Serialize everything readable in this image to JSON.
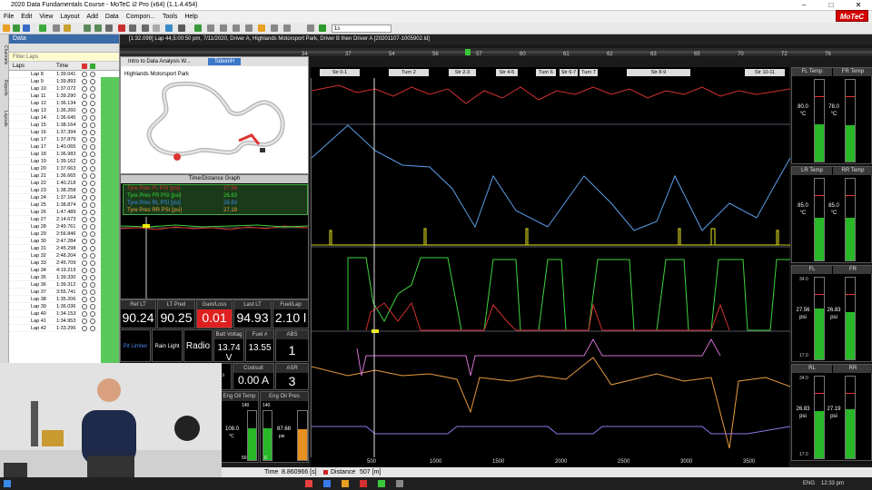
{
  "window": {
    "title": "2020 Data Fundamentals Course - MoTeC i2 Pro (x64) (1.1.4.454)"
  },
  "menu": [
    "File",
    "Edit",
    "View",
    "Layout",
    "Add",
    "Data",
    "Compon...",
    "Tools",
    "Help"
  ],
  "brand": {
    "logo": "MoTeC"
  },
  "toolbar": {
    "lap_selector": "1s"
  },
  "side_tabs": [
    "Channels",
    "Reports",
    "Layouts"
  ],
  "data_panel": {
    "title": "Data",
    "filter_placeholder": "Filter Laps",
    "col_laps": "Laps",
    "col_time": "Time",
    "laps": [
      {
        "lap": "Lap 8",
        "time": "1:39.041"
      },
      {
        "lap": "Lap 9",
        "time": "1:39.893"
      },
      {
        "lap": "Lap 10",
        "time": "1:37.072"
      },
      {
        "lap": "Lap 11",
        "time": "1:39.290"
      },
      {
        "lap": "Lap 12",
        "time": "1:36.134"
      },
      {
        "lap": "Lap 13",
        "time": "1:36.260"
      },
      {
        "lap": "Lap 14",
        "time": "1:36.645"
      },
      {
        "lap": "Lap 15",
        "time": "1:38.164"
      },
      {
        "lap": "Lap 16",
        "time": "1:37.394"
      },
      {
        "lap": "Lap 17",
        "time": "1:37.879"
      },
      {
        "lap": "Lap 17",
        "time": "1:40.065"
      },
      {
        "lap": "Lap 18",
        "time": "1:36.983"
      },
      {
        "lap": "Lap 19",
        "time": "1:39.162"
      },
      {
        "lap": "Lap 20",
        "time": "1:37.663"
      },
      {
        "lap": "Lap 21",
        "time": "1:36.665"
      },
      {
        "lap": "Lap 22",
        "time": "1:40.218"
      },
      {
        "lap": "Lap 23",
        "time": "1:38.258"
      },
      {
        "lap": "Lap 24",
        "time": "1:37.164"
      },
      {
        "lap": "Lap 25",
        "time": "1:38.874"
      },
      {
        "lap": "Lap 26",
        "time": "1:47.489"
      },
      {
        "lap": "Lap 27",
        "time": "2:14.673"
      },
      {
        "lap": "Lap 28",
        "time": "2:49.761"
      },
      {
        "lap": "Lap 29",
        "time": "2:56.846"
      },
      {
        "lap": "Lap 30",
        "time": "2:47.284"
      },
      {
        "lap": "Lap 31",
        "time": "2:45.298"
      },
      {
        "lap": "Lap 32",
        "time": "2:48.204"
      },
      {
        "lap": "Lap 33",
        "time": "2:45.709"
      },
      {
        "lap": "Lap 34",
        "time": "4:19.219"
      },
      {
        "lap": "Lap 35",
        "time": "1:39.330"
      },
      {
        "lap": "Lap 36",
        "time": "1:39.312"
      },
      {
        "lap": "Lap 37",
        "time": "3:55.741"
      },
      {
        "lap": "Lap 38",
        "time": "1:35.206"
      },
      {
        "lap": "Lap 39",
        "time": "1:36.036"
      },
      {
        "lap": "Lap 40",
        "time": "1:34.153"
      },
      {
        "lap": "Lap 41",
        "time": "1:34.953"
      },
      {
        "lap": "Lap 42",
        "time": "1:33.296"
      }
    ]
  },
  "filebar": {
    "text": "[1:32.099] Lap 44,5:00:50 pm, 7/11/2020, Driver A, Highlands Motorsport Park, Driver B then Driver A [20201107-1005902.ld]"
  },
  "timebar": {
    "marks": [
      "34",
      "37",
      "54",
      "56",
      "57",
      "60",
      "61",
      "62",
      "63",
      "65",
      "70",
      "72",
      "76"
    ]
  },
  "track_panel": {
    "tab_label": "Intro to Data Analysis W...",
    "track_name": "Highlands Motorsport Park",
    "badge": "ToboniH"
  },
  "td_graph": {
    "title": "Time/Distance Graph",
    "legend": [
      {
        "name": "Tyre Pres FL PSI [psi]",
        "value": "27.56",
        "color": "#d43030"
      },
      {
        "name": "Tyre Pres FR PSI [psi]",
        "value": "26.83",
        "color": "#3cd43c"
      },
      {
        "name": "Tyre Pres RL PSI [psi]",
        "value": "26.83",
        "color": "#3c8ce8"
      },
      {
        "name": "Tyre Pres RR PSI [psi]",
        "value": "27.19",
        "color": "#e8a040"
      }
    ]
  },
  "display": {
    "row1": [
      {
        "label": "Ref LT",
        "value": "90.24"
      },
      {
        "label": "LT Pred",
        "value": "90.25"
      },
      {
        "label": "Gain/Loss",
        "value": "0.01"
      },
      {
        "label": "Last LT",
        "value": "94.93"
      },
      {
        "label": "Fuel/Lap",
        "value": "2.10 l"
      }
    ],
    "row2": {
      "pit_limiter": "Pit Limiter",
      "rain_light": "Rain Light",
      "radio": "Radio",
      "batt_label": "Batt Voltag",
      "batt_value": "13.74 V",
      "fuel_label": "Fuel #",
      "fuel_value": "13.55",
      "abs_label": "ABS",
      "abs_value": "1"
    },
    "row3": {
      "coolsuit_label": "Coolsuit",
      "coolsuit_value": "0.00 A",
      "asr_label": "ASR",
      "asr_value": "3",
      "left_partial": "ents"
    },
    "row4": [
      {
        "label": "ra Eng Oil Temp",
        "top": "140",
        "value": "108.0",
        "unit": "°C",
        "bottom": "50",
        "level": 0.64
      },
      {
        "label": "Eng Oil Pres",
        "top": "140",
        "value": "87.68",
        "unit": "psi",
        "bottom": "0",
        "level": 0.63
      }
    ]
  },
  "sectors": [
    {
      "label": "Str 0-1"
    },
    {
      "label": "Turn 2"
    },
    {
      "label": "Str 2-3"
    },
    {
      "label": "Str 4-5"
    },
    {
      "label": "Turn 6"
    },
    {
      "label": "Str 6-7"
    },
    {
      "label": "Turn 7"
    },
    {
      "label": "Str 8-9"
    },
    {
      "label": "Str 10-11"
    }
  ],
  "xaxis": {
    "ticks": [
      "500",
      "1000",
      "1500",
      "2000",
      "2500",
      "3000",
      "3500"
    ]
  },
  "gauges": [
    {
      "left": "FL Temp",
      "right": "FR Temp",
      "lval": "80.0",
      "rval": "78.0",
      "unit": "°C",
      "llevel": 0.46,
      "rlevel": 0.44
    },
    {
      "left": "LR Temp",
      "right": "RR Temp",
      "lval": "85.0",
      "rval": "85.0",
      "unit": "°C",
      "llevel": 0.52,
      "rlevel": 0.52
    },
    {
      "left": "FL",
      "right": "FR",
      "top": "34.0",
      "bottom": "17.0",
      "lval": "27.56",
      "rval": "26.83",
      "unit": "psi",
      "llevel": 0.62,
      "rlevel": 0.58
    },
    {
      "left": "RL",
      "right": "RR",
      "top": "34.0",
      "bottom": "17.0",
      "lval": "26.83",
      "rval": "27.19",
      "unit": "psi",
      "llevel": 0.58,
      "rlevel": 0.6
    }
  ],
  "status": {
    "time_label": "Time",
    "time_value": "8.860966 [s]",
    "dist_label": "Distance",
    "dist_value": "507 [m]"
  },
  "taskbar": {
    "lang": "ENG",
    "clock": "12:33 pm"
  }
}
